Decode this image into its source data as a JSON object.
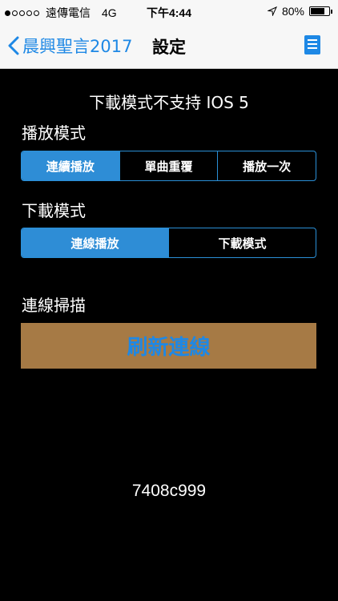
{
  "status": {
    "carrier": "遠傳電信",
    "network": "4G",
    "time": "下午4:44",
    "battery": "80%",
    "battery_level": 0.8
  },
  "nav": {
    "back_label": "晨興聖言2017",
    "title": "設定"
  },
  "content": {
    "notice": "下載模式不支持 IOS 5",
    "play_mode": {
      "label": "播放模式",
      "options": [
        "連續播放",
        "單曲重覆",
        "播放一次"
      ],
      "selected": "連續播放"
    },
    "download_mode": {
      "label": "下載模式",
      "options": [
        "連線播放",
        "下載模式"
      ],
      "selected": "連線播放"
    },
    "scan_label": "連線掃描",
    "refresh_button": "刷新連線",
    "code": "7408c999"
  },
  "colors": {
    "accent": "#2e8dd6",
    "button_bg": "#a67a45",
    "button_text": "#1e88e5"
  }
}
